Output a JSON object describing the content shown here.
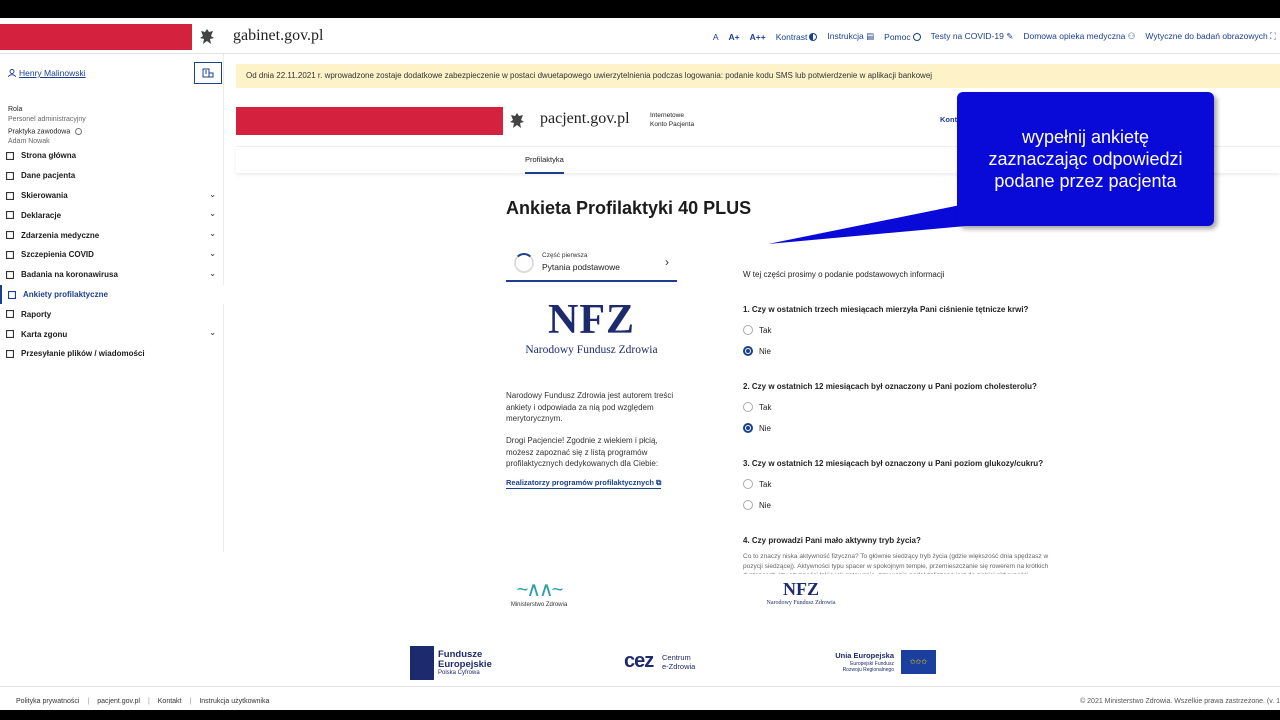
{
  "header": {
    "site_name": "gabinet.gov.pl",
    "nav": {
      "font_a": "A",
      "font_a_plus": "A+",
      "font_a_plus_plus": "A++",
      "contrast": "Kontrast",
      "instruction": "Instrukcja",
      "help": "Pomoc",
      "covid_tests": "Testy na COVID-19",
      "home_care": "Domowa opieka medyczna",
      "imaging_guidelines": "Wytyczne do badań obrazowych"
    }
  },
  "sidebar": {
    "user_name": "Henry Malinowski",
    "role_label": "Rola",
    "role_value": "Personel administracyjny",
    "practice_label": "Praktyka zawodowa",
    "practice_value": "Adam Nowak",
    "items": [
      {
        "label": "Strona główna",
        "has_chevron": false,
        "active": false
      },
      {
        "label": "Dane pacjenta",
        "has_chevron": false,
        "active": false
      },
      {
        "label": "Skierowania",
        "has_chevron": true,
        "active": false
      },
      {
        "label": "Deklaracje",
        "has_chevron": true,
        "active": false
      },
      {
        "label": "Zdarzenia medyczne",
        "has_chevron": true,
        "active": false
      },
      {
        "label": "Szczepienia COVID",
        "has_chevron": true,
        "active": false
      },
      {
        "label": "Badania na koronawirusa",
        "has_chevron": true,
        "active": false
      },
      {
        "label": "Ankiety profilaktyczne",
        "has_chevron": false,
        "active": true
      },
      {
        "label": "Raporty",
        "has_chevron": false,
        "active": false
      },
      {
        "label": "Karta zgonu",
        "has_chevron": true,
        "active": false
      },
      {
        "label": "Przesyłanie plików / wiadomości",
        "has_chevron": false,
        "active": false
      }
    ]
  },
  "banner": {
    "text": "Od dnia 22.11.2021 r. wprowadzone zostaje dodatkowe zabezpieczenie w postaci dwuetapowego uwierzytelnienia podczas logowania: podanie kodu SMS lub potwierdzenie w aplikacji bankowej"
  },
  "pacjent": {
    "site_name": "pacjent.gov.pl",
    "subtitle_line1": "Internetowe",
    "subtitle_line2": "Konto Pacjenta",
    "konto_link": "Kont",
    "tab_active": "Profilaktyka"
  },
  "survey": {
    "title": "Ankieta Profilaktyki 40 PLUS",
    "part_small": "Część pierwsza",
    "part_big": "Pytania podstawowe",
    "nfz_letters": "NFZ",
    "nfz_name": "Narodowy Fundusz Zdrowia",
    "nfz_p1": "Narodowy Fundusz Zdrowia jest autorem treści ankiety i odpowiada za nią pod względem merytorycznym.",
    "nfz_p2": "Drogi Pacjencie! Zgodnie z wiekiem i płcią, możesz zapoznać się z listą programów profilaktycznych dedykowanych dla Ciebie:",
    "nfz_link": "Realizatorzy programów profilaktycznych",
    "intro": "W tej części prosimy o podanie podstawowych informacji",
    "questions": [
      {
        "text": "1. Czy w ostatnich trzech miesiącach mierzyła Pani ciśnienie tętnicze krwi?",
        "yes": "Tak",
        "no": "Nie",
        "selected": "no"
      },
      {
        "text": "2. Czy w ostatnich 12 miesiącach był oznaczony u Pani poziom cholesterolu?",
        "yes": "Tak",
        "no": "Nie",
        "selected": "no"
      },
      {
        "text": "3. Czy w ostatnich 12 miesiącach był oznaczony u Pani poziom glukozy/cukru?",
        "yes": "Tak",
        "no": "Nie",
        "selected": "none"
      },
      {
        "text": "4. Czy prowadzi Pani mało aktywny tryb życia?"
      }
    ],
    "q4_help": "Co to znaczy niska aktywność fizyczna? To głównie siedzący tryb życia (gdzie większość dnia spędzasz w pozycji siedzącej). Aktywności typu spacer w spokojnym tempie, przemieszczanie się rowerem na krótkich dystansach czy czynności takie jak gotowanie, zmywanie nadal zaliczana jest do niskiej aktywności fizycznej."
  },
  "callout": {
    "line1": "wypełnij ankietę",
    "line2": "zaznaczając odpowiedzi",
    "line3": "podane przez pacjenta"
  },
  "logos": {
    "mz": "Ministerstwo Zdrowia",
    "nfz_mini": "NFZ",
    "nfz_mini_name": "Narodowy Fundusz Zdrowia",
    "fe_line1": "Fundusze",
    "fe_line2": "Europejskie",
    "fe_sub": "Polska Cyfrowa",
    "cez_mark": "cez",
    "cez_line1": "Centrum",
    "cez_line2": "e-Zdrowia",
    "ue_title": "Unia Europejska",
    "ue_sub": "Europejski Fundusz Rozwoju Regionalnego"
  },
  "footer": {
    "privacy": "Polityka prywatności",
    "pacjent": "pacjent.gov.pl",
    "contact": "Kontakt",
    "manual": "Instrukcja użytkownika",
    "copyright": "© 2021 Ministerstwo Zdrowia. Wszelkie prawa zastrzeżone. (v. 1"
  },
  "colors": {
    "brand_red": "#d4213d",
    "link_blue": "#1a3f8f",
    "callout_blue": "#0a0ad8",
    "banner_yellow": "#fdf2c8"
  }
}
